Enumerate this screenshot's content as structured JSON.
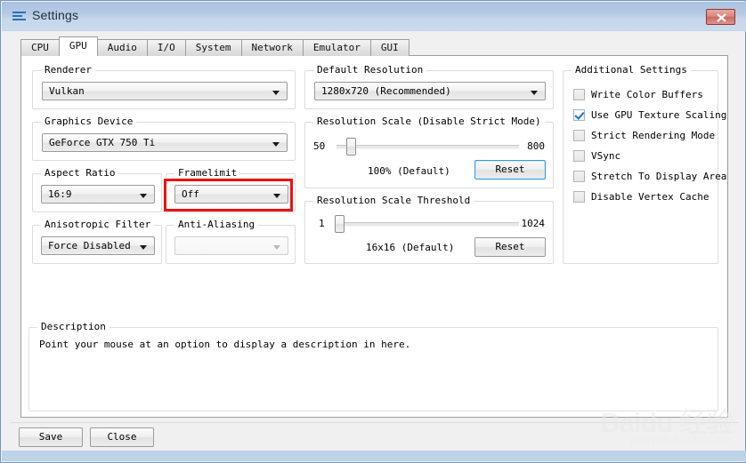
{
  "window": {
    "title": "Settings",
    "icon": "menu-lines-icon",
    "close_label": "x",
    "titlebar_color": "#b6cbe4",
    "accent_color": "#2b6fba"
  },
  "tabs": [
    {
      "label": "CPU",
      "active": false
    },
    {
      "label": "GPU",
      "active": true
    },
    {
      "label": "Audio",
      "active": false
    },
    {
      "label": "I/O",
      "active": false
    },
    {
      "label": "System",
      "active": false
    },
    {
      "label": "Network",
      "active": false
    },
    {
      "label": "Emulator",
      "active": false
    },
    {
      "label": "GUI",
      "active": false
    }
  ],
  "gpu": {
    "renderer": {
      "label": "Renderer",
      "value": "Vulkan"
    },
    "graphics_device": {
      "label": "Graphics Device",
      "value": "GeForce GTX 750 Ti"
    },
    "aspect_ratio": {
      "label": "Aspect Ratio",
      "value": "16:9"
    },
    "framelimit": {
      "label": "Framelimit",
      "value": "Off",
      "highlighted": true
    },
    "anisotropic_filter": {
      "label": "Anisotropic Filter",
      "value": "Force Disabled"
    },
    "anti_aliasing": {
      "label": "Anti-Aliasing",
      "value": "",
      "disabled": true
    },
    "default_resolution": {
      "label": "Default Resolution",
      "value": "1280x720 (Recommended)"
    },
    "resolution_scale": {
      "label": "Resolution Scale (Disable Strict Mode)",
      "min": "50",
      "max": "800",
      "value_text": "100% (Default)",
      "reset_label": "Reset",
      "thumb_percent": 6
    },
    "resolution_scale_threshold": {
      "label": "Resolution Scale Threshold",
      "min": "1",
      "max": "1024",
      "value_text": "16x16 (Default)",
      "reset_label": "Reset",
      "thumb_percent": 1
    },
    "additional_settings": {
      "label": "Additional Settings",
      "items": [
        {
          "label": "Write Color Buffers",
          "checked": false
        },
        {
          "label": "Use GPU Texture Scaling",
          "checked": true
        },
        {
          "label": "Strict Rendering Mode",
          "checked": false
        },
        {
          "label": "VSync",
          "checked": false
        },
        {
          "label": "Stretch To Display Area",
          "checked": false
        },
        {
          "label": "Disable Vertex Cache",
          "checked": false
        }
      ]
    }
  },
  "description": {
    "label": "Description",
    "text": "Point your mouse at an option to display a description in here."
  },
  "footer": {
    "save_label": "Save",
    "close_label": "Close"
  },
  "watermark": {
    "main": "Baidu 经验",
    "sub": "jingyan.baidu.com"
  }
}
